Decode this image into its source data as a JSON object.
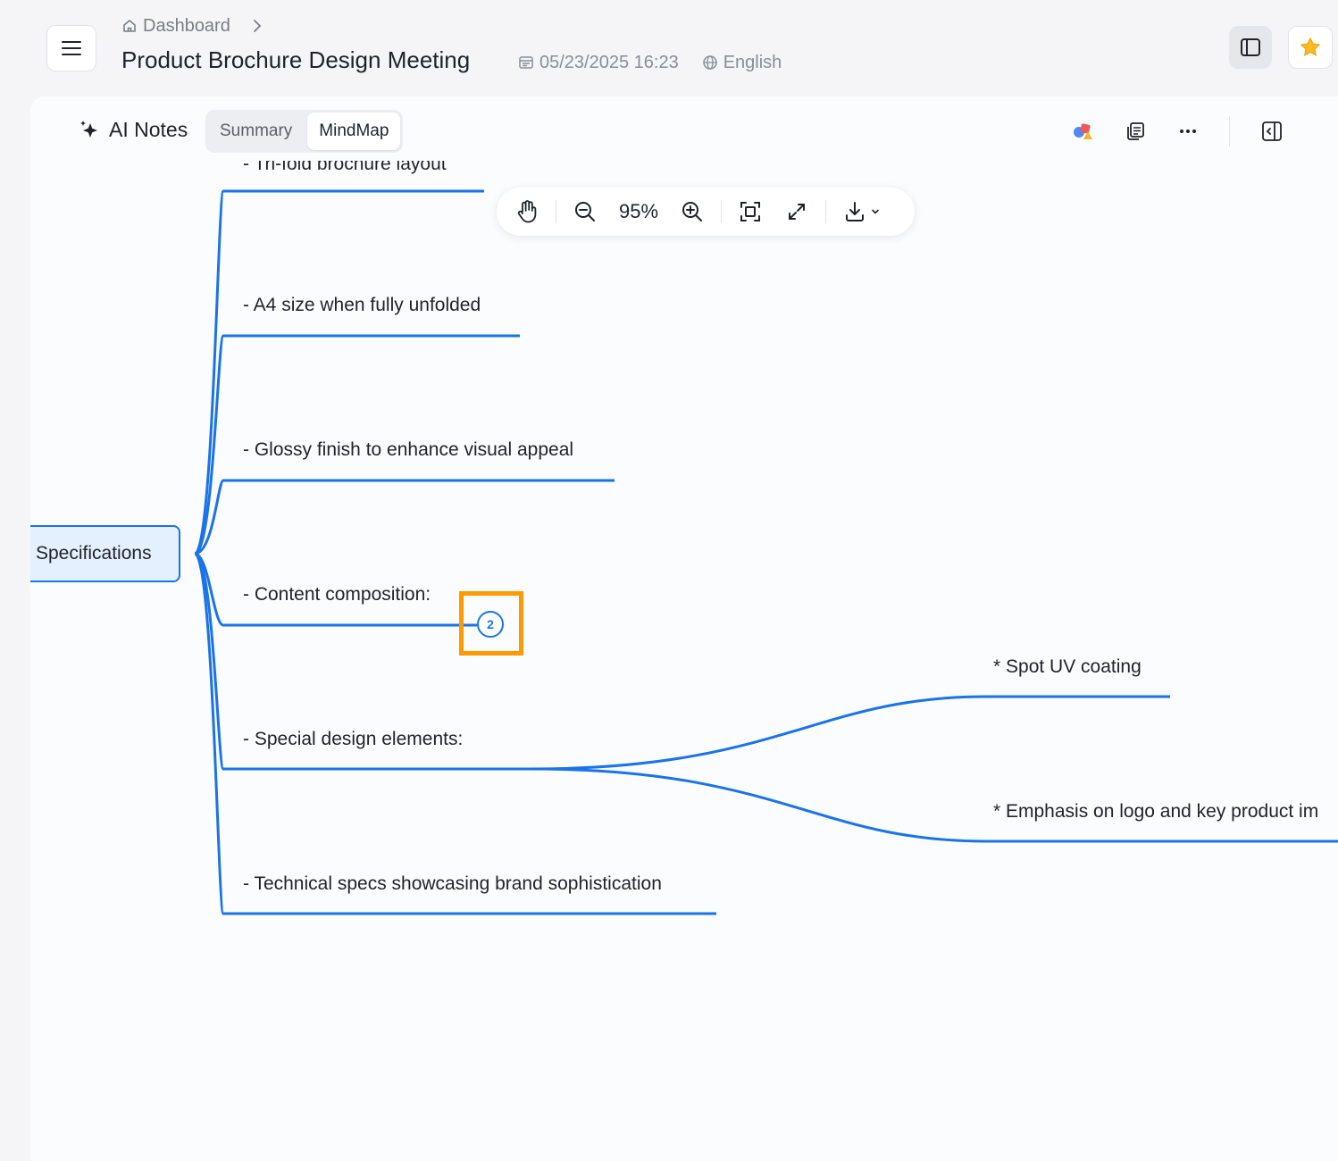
{
  "header": {
    "breadcrumb": {
      "home_label": "Dashboard",
      "home_icon": "home-icon",
      "separator_icon": "chevron-right-icon"
    },
    "title": "Product Brochure Design Meeting",
    "datetime": "05/23/2025 16:23",
    "language": "English",
    "colors": {
      "star": "#fbb829"
    }
  },
  "notes": {
    "title": "AI Notes",
    "tabs": [
      {
        "label": "Summary",
        "active": false
      },
      {
        "label": "MindMap",
        "active": true
      }
    ]
  },
  "toolbar": {
    "zoom": "95%",
    "icons": [
      "hand-pan-icon",
      "zoom-out-icon",
      "zoom-in-icon",
      "fit-screen-icon",
      "fullscreen-icon",
      "download-icon"
    ]
  },
  "mindmap": {
    "root": "Specifications",
    "branches": [
      "- Tri-fold brochure layout",
      "- A4 size when fully unfolded",
      "- Glossy finish to enhance visual appeal",
      "- Content composition:",
      "- Special design elements:",
      "- Technical specs showcasing brand sophistication"
    ],
    "sub_branches": [
      "* Spot UV coating",
      "* Emphasis on logo and key product im"
    ],
    "collapsed_count": "2",
    "colors": {
      "line": "#1a73e8",
      "root_fill": "#e4f0fd",
      "highlight": "#ff9a00"
    }
  }
}
